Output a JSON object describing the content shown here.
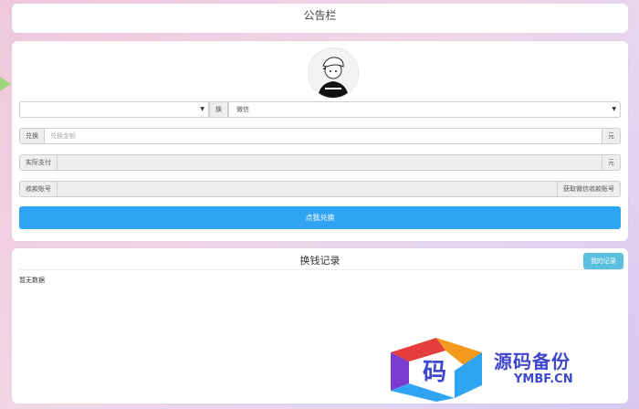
{
  "notice": {
    "title": "公告栏"
  },
  "form": {
    "source_select": {
      "value": ""
    },
    "swap_label": "换",
    "target_select": {
      "value": "微信"
    },
    "exchange_label": "兑换",
    "exchange_placeholder": "兑换金额",
    "currency_unit": "元",
    "actual_pay_label": "实际支付",
    "actual_pay_unit": "元",
    "account_label": "收款账号",
    "get_account_label": "获取微信收款账号",
    "submit_label": "点我兑换"
  },
  "records": {
    "title": "换钱记录",
    "my_records_label": "我的记录",
    "empty_text": "暂无数据"
  },
  "watermark": {
    "glyph": "码",
    "name": "源码备份",
    "domain": "YMBF.CN",
    "colors": {
      "red": "#e53c3c",
      "orange": "#f39a1e",
      "blue": "#2fa4f2",
      "purple": "#7a3ccf"
    }
  }
}
